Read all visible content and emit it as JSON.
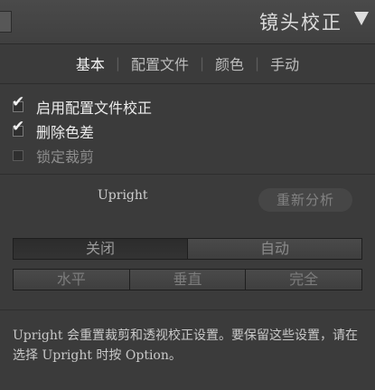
{
  "header": {
    "title": "镜头校正"
  },
  "tabs": [
    {
      "label": "基本",
      "active": true
    },
    {
      "label": "配置文件",
      "active": false
    },
    {
      "label": "颜色",
      "active": false
    },
    {
      "label": "手动",
      "active": false
    }
  ],
  "tab_separator": "|",
  "checkboxes": [
    {
      "label": "启用配置文件校正",
      "checked": true
    },
    {
      "label": "删除色差",
      "checked": true
    },
    {
      "label": "锁定裁剪",
      "checked": false
    }
  ],
  "check_glyph": "✔",
  "upright": {
    "label": "Upright",
    "reanalyze_button": "重新分析",
    "row1": [
      {
        "label": "关闭",
        "selected": true
      },
      {
        "label": "自动",
        "selected": false
      }
    ],
    "row2": [
      {
        "label": "水平"
      },
      {
        "label": "垂直"
      },
      {
        "label": "完全"
      }
    ]
  },
  "info_text": "Upright 会重置裁剪和透视校正设置。要保留这些设置，请在选择 Upright 时按 Option。",
  "colors": {
    "panel_bg": "#3b3b3b",
    "header_bg": "#444444",
    "text_primary": "#ececec",
    "text_muted": "#8e8e8e"
  },
  "icons": {
    "header_caret": "triangle-down-icon",
    "checkbox_tick": "check-icon"
  }
}
